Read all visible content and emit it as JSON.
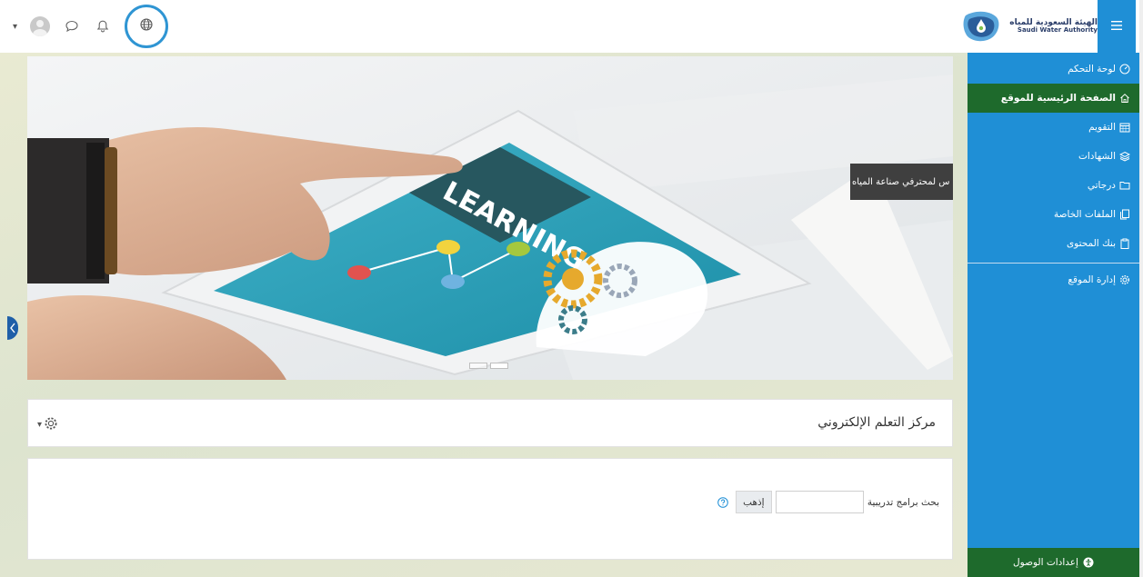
{
  "brand": {
    "name_ar": "الهيئة السعودية للمياه",
    "name_en": "Saudi Water Authority"
  },
  "navbar": {
    "menu_toggle_icon": "hamburger-icon",
    "icons": [
      "user-menu-caret",
      "avatar",
      "message-icon",
      "bell-icon",
      "globe-icon"
    ]
  },
  "sidebar": {
    "items": [
      {
        "label": "لوحة التحكم",
        "icon": "gauge-icon"
      },
      {
        "label": "الصفحة الرئيسية للموقع",
        "icon": "home-icon",
        "active": true
      },
      {
        "label": "التقويم",
        "icon": "calendar-icon"
      },
      {
        "label": "الشهادات",
        "icon": "layers-icon"
      },
      {
        "label": "درجاتي",
        "icon": "folder-icon"
      },
      {
        "label": "الملفات الخاصة",
        "icon": "files-icon"
      },
      {
        "label": "بنك المحتوى",
        "icon": "clipboard-icon"
      }
    ],
    "admin_item": {
      "label": "إدارة الموقع",
      "icon": "gear-icon"
    },
    "footer": {
      "label": "إعدادات الوصول",
      "icon": "accessibility-icon"
    }
  },
  "carousel": {
    "caption": "س لمحترفي صناعة المياه",
    "image_text": "LEARNING",
    "slides": 2,
    "active_slide": 2
  },
  "main": {
    "site_title": "مركز التعلم الإلكتروني",
    "search": {
      "label": "بحث برامج تدريبية",
      "value": "",
      "button": "إذهب"
    }
  },
  "colors": {
    "sidebar": "#1f8fd6",
    "active": "#1e6a2c",
    "accent": "#2f95d3"
  }
}
